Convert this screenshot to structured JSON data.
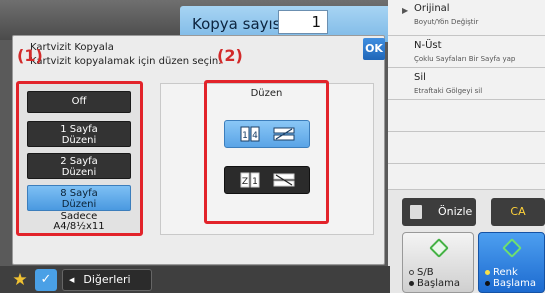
{
  "copies": {
    "label": "Kopya sayısı",
    "value": "1"
  },
  "right_panel": {
    "items": [
      {
        "title": "Orijinal",
        "sub": "Boyut/Yön Değiştir"
      },
      {
        "title": "N-Üst",
        "sub": "Çoklu Sayfaları Bir Sayfa yap"
      },
      {
        "title": "Sil",
        "sub": "Etraftaki Gölgeyi sil"
      }
    ],
    "preview_label": "Önizle",
    "ca_label": "CA",
    "bw_start": {
      "line1": "S/B",
      "line2": "Başlama"
    },
    "color_start": {
      "line1": "Renk",
      "line2": "Başlama"
    }
  },
  "bottom": {
    "others_label": "Diğerleri"
  },
  "modal": {
    "title": "Kartvizit Kopyala",
    "subtitle": "Kartvizit kopyalamak için düzen seçin.",
    "ok_label": "OK",
    "callout_1": "(1)",
    "callout_2": "(2)",
    "options": [
      {
        "l1": "Off",
        "l2": ""
      },
      {
        "l1": "1 Sayfa",
        "l2": "Düzeni"
      },
      {
        "l1": "2 Sayfa",
        "l2": "Düzeni"
      },
      {
        "l1": "8 Sayfa",
        "l2": "Düzeni"
      }
    ],
    "selected_option": "8 Sayfa Düzeni",
    "last_option": {
      "l1": "Sadece",
      "l2": "A4/8½x11"
    },
    "layout_label": "Düzen"
  },
  "colors": {
    "accent_blue": "#4a99e0",
    "callout_red": "#e2232a",
    "ca_yellow": "#ffd23a"
  }
}
